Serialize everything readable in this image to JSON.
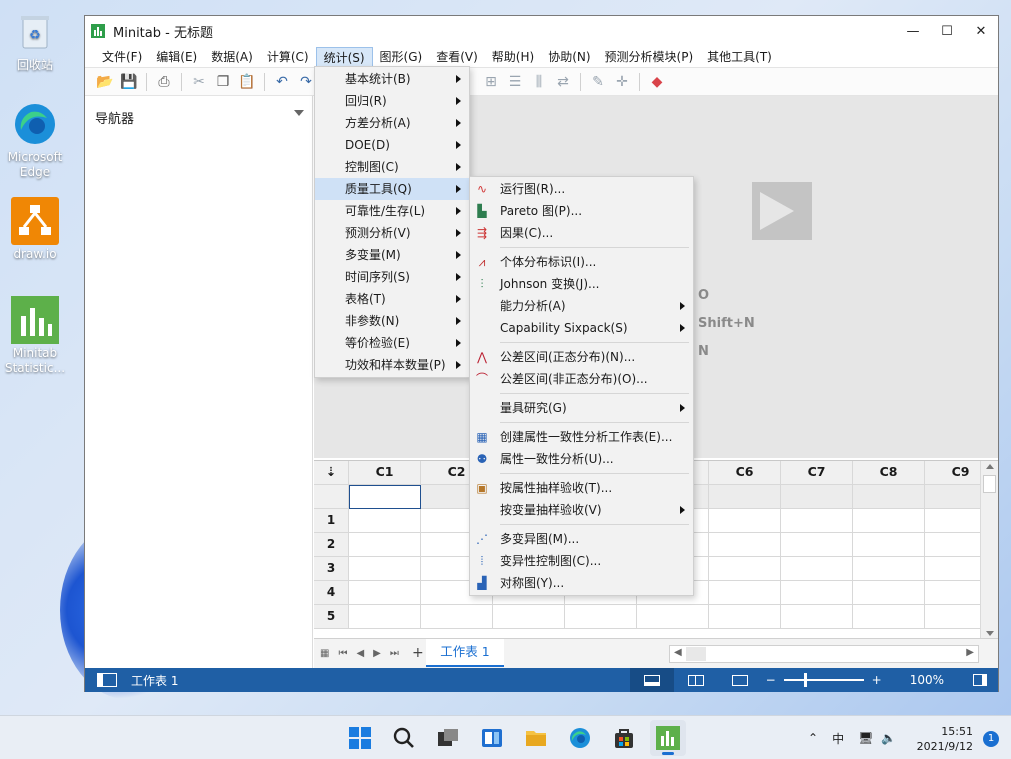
{
  "desktop": {
    "icons": [
      {
        "label": "回收站"
      },
      {
        "label": "Microsoft Edge"
      },
      {
        "label": "draw.io"
      },
      {
        "label": "Minitab Statistic..."
      }
    ]
  },
  "window": {
    "title": "Minitab - 无标题",
    "controls": {
      "minimize": "—",
      "maximize": "☐",
      "close": "✕"
    }
  },
  "menubar": [
    "文件(F)",
    "编辑(E)",
    "数据(A)",
    "计算(C)",
    "统计(S)",
    "图形(G)",
    "查看(V)",
    "帮助(H)",
    "协助(N)",
    "预测分析模块(P)",
    "其他工具(T)"
  ],
  "navigator": {
    "title": "导航器"
  },
  "output": {
    "shortcuts": [
      "O",
      "Shift+N",
      "N"
    ]
  },
  "stat_menu": [
    {
      "label": "基本统计(B)",
      "submenu": true
    },
    {
      "label": "回归(R)",
      "submenu": true
    },
    {
      "label": "方差分析(A)",
      "submenu": true
    },
    {
      "label": "DOE(D)",
      "submenu": true
    },
    {
      "label": "控制图(C)",
      "submenu": true
    },
    {
      "label": "质量工具(Q)",
      "submenu": true,
      "highlighted": true
    },
    {
      "label": "可靠性/生存(L)",
      "submenu": true
    },
    {
      "label": "预测分析(V)",
      "submenu": true
    },
    {
      "label": "多变量(M)",
      "submenu": true
    },
    {
      "label": "时间序列(S)",
      "submenu": true
    },
    {
      "label": "表格(T)",
      "submenu": true
    },
    {
      "label": "非参数(N)",
      "submenu": true
    },
    {
      "label": "等价检验(E)",
      "submenu": true
    },
    {
      "label": "功效和样本数量(P)",
      "submenu": true
    }
  ],
  "quality_menu": {
    "group1": [
      {
        "label": "运行图(R)...",
        "icon": "run-chart-icon"
      },
      {
        "label": "Pareto 图(P)...",
        "icon": "pareto-icon"
      },
      {
        "label": "因果(C)...",
        "icon": "fishbone-icon"
      }
    ],
    "group2": [
      {
        "label": "个体分布标识(I)...",
        "icon": "distribution-icon"
      },
      {
        "label": "Johnson 变换(J)...",
        "icon": "johnson-icon"
      },
      {
        "label": "能力分析(A)",
        "submenu": true
      },
      {
        "label": "Capability Sixpack(S)",
        "submenu": true
      }
    ],
    "group3": [
      {
        "label": "公差区间(正态分布)(N)...",
        "icon": "tolerance-normal-icon"
      },
      {
        "label": "公差区间(非正态分布)(O)...",
        "icon": "tolerance-nonnormal-icon"
      }
    ],
    "group4": [
      {
        "label": "量具研究(G)",
        "submenu": true
      }
    ],
    "group5": [
      {
        "label": "创建属性一致性分析工作表(E)...",
        "icon": "worksheet-icon"
      },
      {
        "label": "属性一致性分析(U)...",
        "icon": "agreement-icon"
      }
    ],
    "group6": [
      {
        "label": "按属性抽样验收(T)...",
        "icon": "sampling-icon"
      },
      {
        "label": "按变量抽样验收(V)",
        "submenu": true
      }
    ],
    "group7": [
      {
        "label": "多变异图(M)...",
        "icon": "multivari-icon"
      },
      {
        "label": "变异性控制图(C)...",
        "icon": "variability-icon"
      },
      {
        "label": "对称图(Y)...",
        "icon": "symmetry-icon"
      }
    ]
  },
  "worksheet": {
    "columns": [
      "C1",
      "C2",
      "",
      "",
      "",
      "C6",
      "C7",
      "C8",
      "C9"
    ],
    "rows": [
      "1",
      "2",
      "3",
      "4",
      "5"
    ],
    "corner": "⇣",
    "tab": "工作表 1",
    "tab_add": "+"
  },
  "statusbar": {
    "sheet": "工作表 1",
    "zoom": "100%",
    "minus": "−",
    "plus": "+"
  },
  "taskbar": {
    "tray_lang": "中",
    "time": "15:51",
    "date": "2021/9/12",
    "notifications": "1"
  }
}
